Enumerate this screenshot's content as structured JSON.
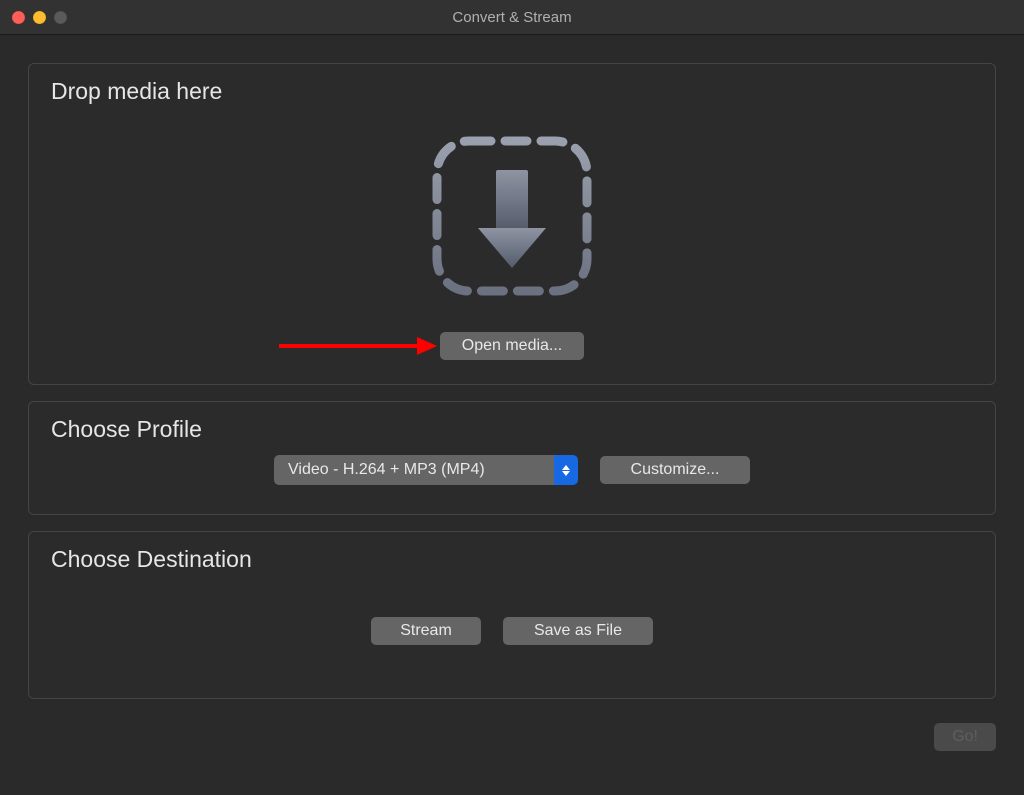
{
  "window": {
    "title": "Convert & Stream"
  },
  "drop": {
    "heading": "Drop media here",
    "open_button": "Open media..."
  },
  "profile": {
    "heading": "Choose Profile",
    "selected": "Video - H.264 + MP3 (MP4)",
    "customize_button": "Customize..."
  },
  "destination": {
    "heading": "Choose Destination",
    "stream_button": "Stream",
    "save_button": "Save as File"
  },
  "footer": {
    "go_button": "Go!"
  },
  "colors": {
    "accent_blue": "#1668e3",
    "annotation_red": "#ff0000"
  }
}
